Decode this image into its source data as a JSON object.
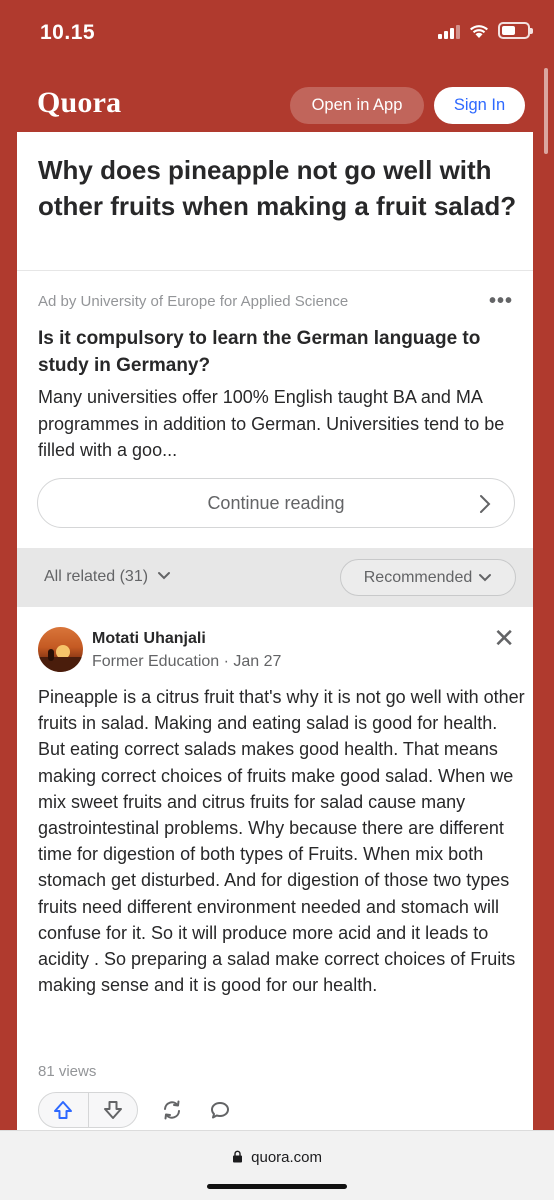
{
  "status_bar": {
    "time": "10.15",
    "signal_bars": 4,
    "signal_active": 3,
    "battery_fraction": 0.55
  },
  "header": {
    "logo": "Quora",
    "open_in_app": "Open in App",
    "sign_in": "Sign In"
  },
  "question": {
    "title": "Why does pineapple not go well with other fruits when making a fruit salad?"
  },
  "ad": {
    "by_line": "Ad by University of Europe for Applied Science",
    "more": "•••",
    "title": "Is it compulsory to learn the German language to study in Germany?",
    "text": "Many universities offer 100% English taught BA and MA programmes in addition to German. Universities tend to be filled with a goo...",
    "continue_label": "Continue reading"
  },
  "related": {
    "all_related": "All related (31)",
    "sort": "Recommended"
  },
  "answer": {
    "author": "Motati Uhanjali",
    "credential": "Former Education · Jan 27",
    "close": "✕",
    "text": "Pineapple is a citrus fruit that's why it is not go well with other fruits in salad. Making and eating salad is good for health. But eating correct salads makes good health. That means making correct choices of fruits make good salad. When we mix sweet fruits and citrus fruits for salad cause many gastrointestinal problems. Why because there are different time for digestion of both types of Fruits. When mix both stomach get disturbed. And for digestion of those two types fruits need different environment needed and stomach will confuse for it. So it will produce more acid and it leads to acidity . So preparing a salad make correct choices of Fruits making sense and it is good for our health.",
    "views": "81 views",
    "icons": [
      "upvote-icon",
      "downvote-icon",
      "share-icon",
      "comment-icon"
    ]
  },
  "browser": {
    "url": "quora.com"
  },
  "colors": {
    "brand": "#b03a2e",
    "link": "#2e69ff"
  }
}
